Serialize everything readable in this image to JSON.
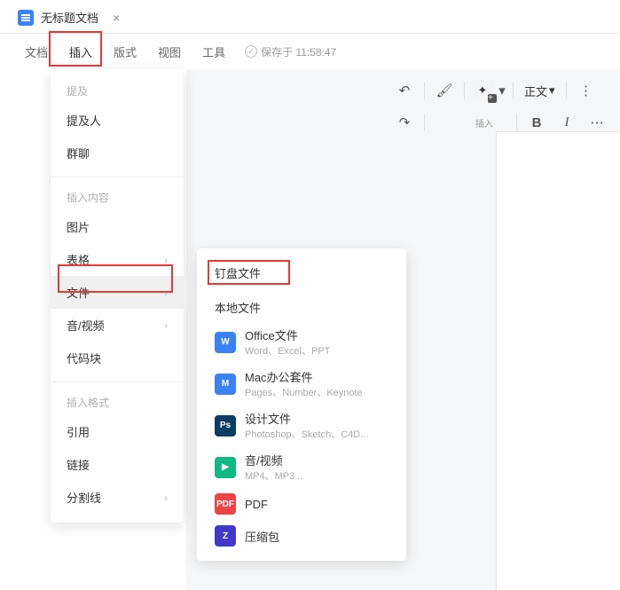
{
  "tab": {
    "title": "无标题文档"
  },
  "menubar": {
    "items": [
      "文档",
      "插入",
      "版式",
      "视图",
      "工具"
    ],
    "saved_label": "保存于 11:58:47"
  },
  "dropdown": {
    "section1_label": "提及",
    "section1_items": [
      "提及人",
      "群聊"
    ],
    "section2_label": "插入内容",
    "section2_items": [
      {
        "label": "图片",
        "arrow": false
      },
      {
        "label": "表格",
        "arrow": true
      },
      {
        "label": "文件",
        "arrow": true,
        "selected": true
      },
      {
        "label": "音/视频",
        "arrow": true
      },
      {
        "label": "代码块",
        "arrow": false
      }
    ],
    "section3_label": "插入格式",
    "section3_items": [
      {
        "label": "引用",
        "arrow": false
      },
      {
        "label": "链接",
        "arrow": false
      },
      {
        "label": "分割线",
        "arrow": true
      }
    ]
  },
  "submenu": {
    "title": "钉盘文件",
    "local_label": "本地文件",
    "files": [
      {
        "name": "Office文件",
        "desc": "Word、Excel、PPT",
        "icon": "W",
        "cls": "ic-word"
      },
      {
        "name": "Mac办公套件",
        "desc": "Pages、Number、Keynote",
        "icon": "M",
        "cls": "ic-mac"
      },
      {
        "name": "设计文件",
        "desc": "Photoshop、Sketch、C4D...",
        "icon": "Ps",
        "cls": "ic-ps"
      },
      {
        "name": "音/视频",
        "desc": "MP4、MP3...",
        "icon": "▶",
        "cls": "ic-av"
      },
      {
        "name": "PDF",
        "desc": "",
        "icon": "PDF",
        "cls": "ic-pdf"
      },
      {
        "name": "压缩包",
        "desc": "",
        "icon": "Z",
        "cls": "ic-zip"
      }
    ]
  },
  "toolbar": {
    "style_label": "正文",
    "insert_small": "插入",
    "bold": "B",
    "italic": "I"
  }
}
